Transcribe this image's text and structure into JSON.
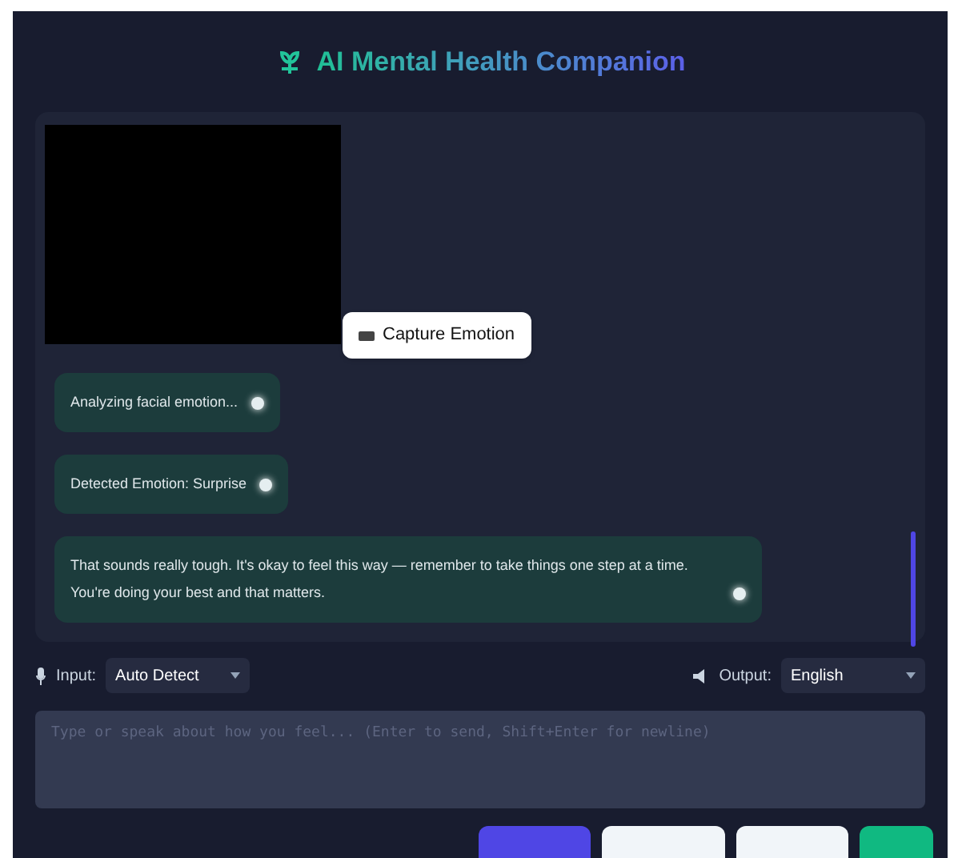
{
  "header": {
    "title": "AI Mental Health Companion"
  },
  "capture_button": {
    "label": "Capture Emotion"
  },
  "messages": [
    {
      "text": "Analyzing facial emotion..."
    },
    {
      "text": "Detected Emotion: Surprise"
    },
    {
      "text": "That sounds really tough. It's okay to feel this way — remember to take things one step at a time. You're doing your best and that matters."
    }
  ],
  "input_language": {
    "label": "Input:",
    "value": "Auto Detect"
  },
  "output_language": {
    "label": "Output:",
    "value": "English"
  },
  "message_field": {
    "placeholder": "Type or speak about how you feel... (Enter to send, Shift+Enter for newline)"
  }
}
